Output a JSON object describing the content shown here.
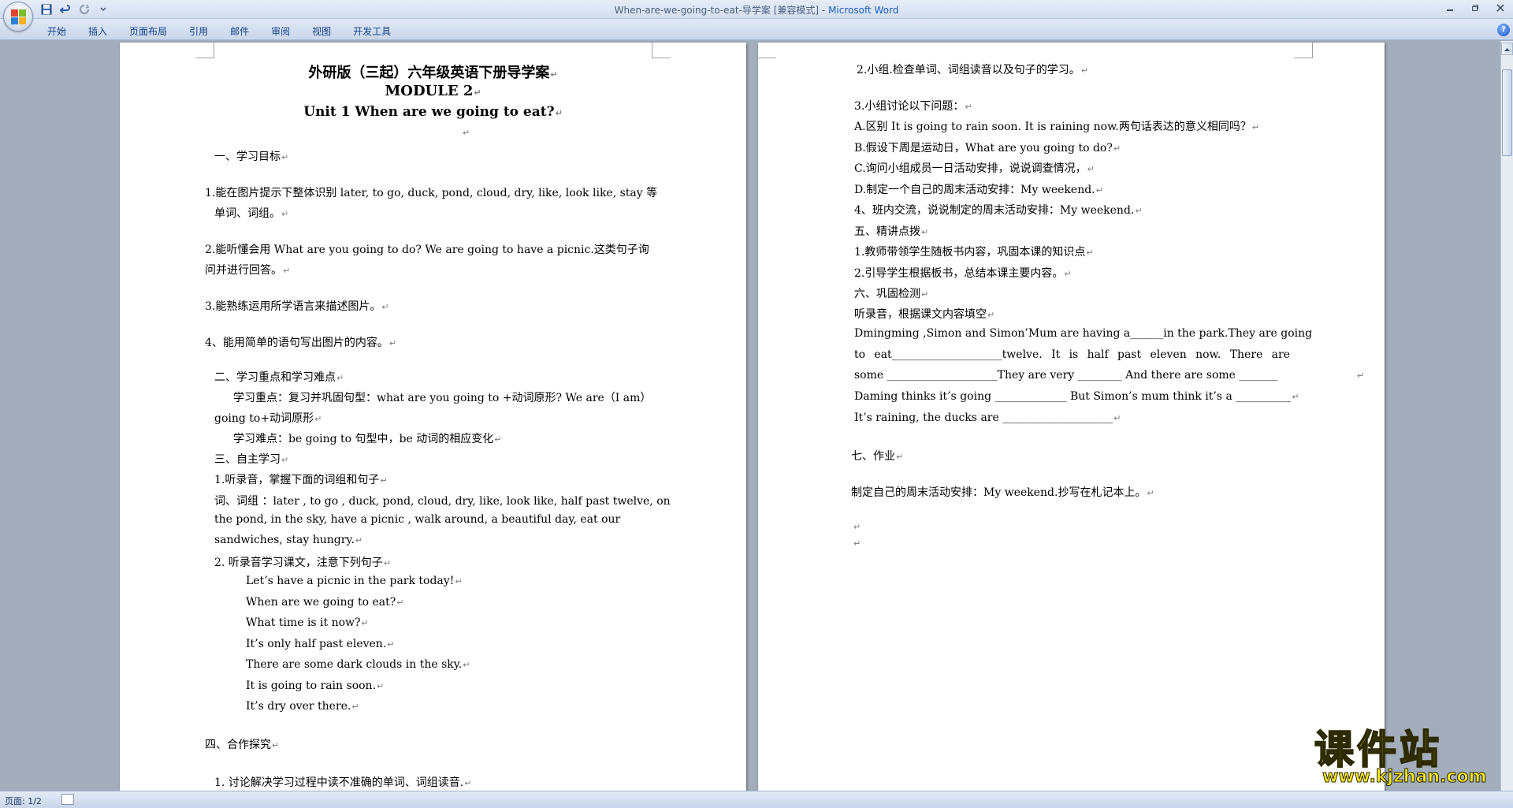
{
  "window": {
    "title": "When-are-we-going-to-eat-导学案 [兼容模式] - ",
    "app_name": "Microsoft Word"
  },
  "ribbon": {
    "tabs": [
      "开始",
      "插入",
      "页面布局",
      "引用",
      "邮件",
      "审阅",
      "视图",
      "开发工具"
    ],
    "help_label": "?"
  },
  "status": {
    "page_label": "页面: 1/2"
  },
  "watermark": {
    "brand": "课件站",
    "url": "www.kjzhan.com"
  },
  "page1": {
    "title": "外研版（三起）六年级英语下册导学案",
    "module": "MODULE 2",
    "unit": "Unit 1 When are we going to eat?",
    "sec1_heading": "一、学习目标",
    "goal1_a": "1.能在图片提示下整体识别 later, to go, duck, pond, cloud, dry, like, look like, stay 等",
    "goal1_b": "单词、词组。",
    "goal2_a": "2.能听懂会用 What are you going to do?      We are going to have a picnic.这类句子询",
    "goal2_b": "问并进行回答。",
    "goal3": "3.能熟练运用所学语言来描述图片。",
    "goal4": "4、能用简单的语句写出图片的内容。",
    "sec2_heading": "二、学习重点和学习难点",
    "key_a": "学习重点：复习并巩固句型：what are you going to +动词原形? We are（I am）",
    "key_b": "going to+动词原形",
    "difficulty": "学习难点：be going to  句型中，be 动词的相应变化",
    "sec3_heading": "三、自主学习",
    "self1": "1.听录音，掌握下面的词组和句子",
    "vocab_a": "词、词组    ：later , to go , duck, pond, cloud, dry,    like, look like, half past twelve, on",
    "vocab_b": "the  pond,  in  the  sky,  have    a  picnic  ,  walk  around,  a  beautiful  day,  eat  our",
    "vocab_c": "sandwiches, stay hungry.",
    "self2": "2.  听录音学习课文，注意下列句子",
    "sentences": [
      "Let’s have a picnic in the park today!",
      "When are we going to eat?",
      "What time is it now?",
      "It’s only half past eleven.",
      "There are some dark clouds in the sky.",
      "It is going to rain soon.",
      "It’s dry over there."
    ],
    "sec4_heading": "四、合作探究",
    "coop1": "1.  讨论解决学习过程中读不准确的单词、词组读音."
  },
  "page2": {
    "coop2": "2.小组.检查单词、词组读音以及句子的学习。",
    "coop3": "3.小组讨论以下问题：",
    "qa": "A.区别 It is going to rain soon. It is raining now.两句话表达的意义相同吗？",
    "qb": "B.假设下周是运动日，What are you going to do?",
    "qc": "C.询问小组成员一日活动安排，说说调查情况，",
    "qd": "D.制定一个自己的周末活动安排：My weekend.",
    "coop4": "4、班内交流，说说制定的周末活动安排：My weekend.",
    "sec5_heading": "五、精讲点拨",
    "p5_1": "1.教师带领学生随板书内容，巩固本课的知识点",
    "p5_2": "2.引导学生根据板书，总结本课主要内容。",
    "sec6_heading": "六、巩固检测",
    "listen": "听录音，根据课文内容填空",
    "fill1": [
      "Dmingming ,Simon and Simon’Mum are having a______in the park.They are going"
    ],
    "fill2": [
      "to",
      "eat____________________twelve.",
      "It",
      "is",
      "half",
      "past",
      "eleven",
      "now.",
      "There",
      "are"
    ],
    "fill3": "some  ____________________They are very  ________  And there are some  _______",
    "fill4": "Daming thinks it’s going  _____________ But Simon’s mum think it’s a  __________",
    "fill5": "It’s raining, the ducks are  ____________________",
    "sec7_heading": "七、作业",
    "homework": "制定自己的周末活动安排：My weekend.抄写在札记本上。"
  }
}
